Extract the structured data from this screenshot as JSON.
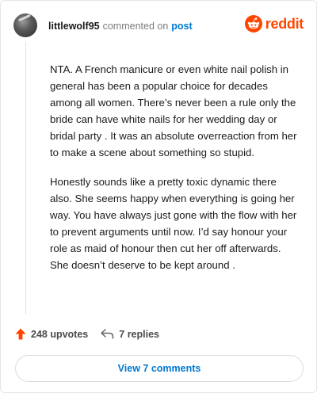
{
  "comment": {
    "username": "littlewolf95",
    "action_text": "commented on",
    "post_link_text": "post",
    "paragraphs": [
      "NTA. A French manicure or even white nail polish in general has been a popular choice for decades among all women. There’s never been a rule only the bride can have white nails for her wedding day or bridal party . It was an absolute overreaction from her to make a scene about something so stupid.",
      "Honestly sounds like a pretty toxic dynamic there also. She seems happy when everything is going her way. You have always just gone with the flow with her to prevent arguments until now. I’d say honour your role as maid of honour then cut her off afterwards. She doesn’t deserve to be kept around ."
    ]
  },
  "brand": {
    "wordmark": "reddit",
    "logo_icon": "reddit-snoo-icon",
    "color": "#ff4500"
  },
  "stats": {
    "upvotes_label": "248 upvotes",
    "upvote_icon": "upvote-arrow-icon",
    "upvote_color": "#ff4500",
    "replies_label": "7 replies",
    "reply_icon": "reply-arrow-icon"
  },
  "view_button": {
    "label": "View 7 comments",
    "color": "#0079d3"
  }
}
